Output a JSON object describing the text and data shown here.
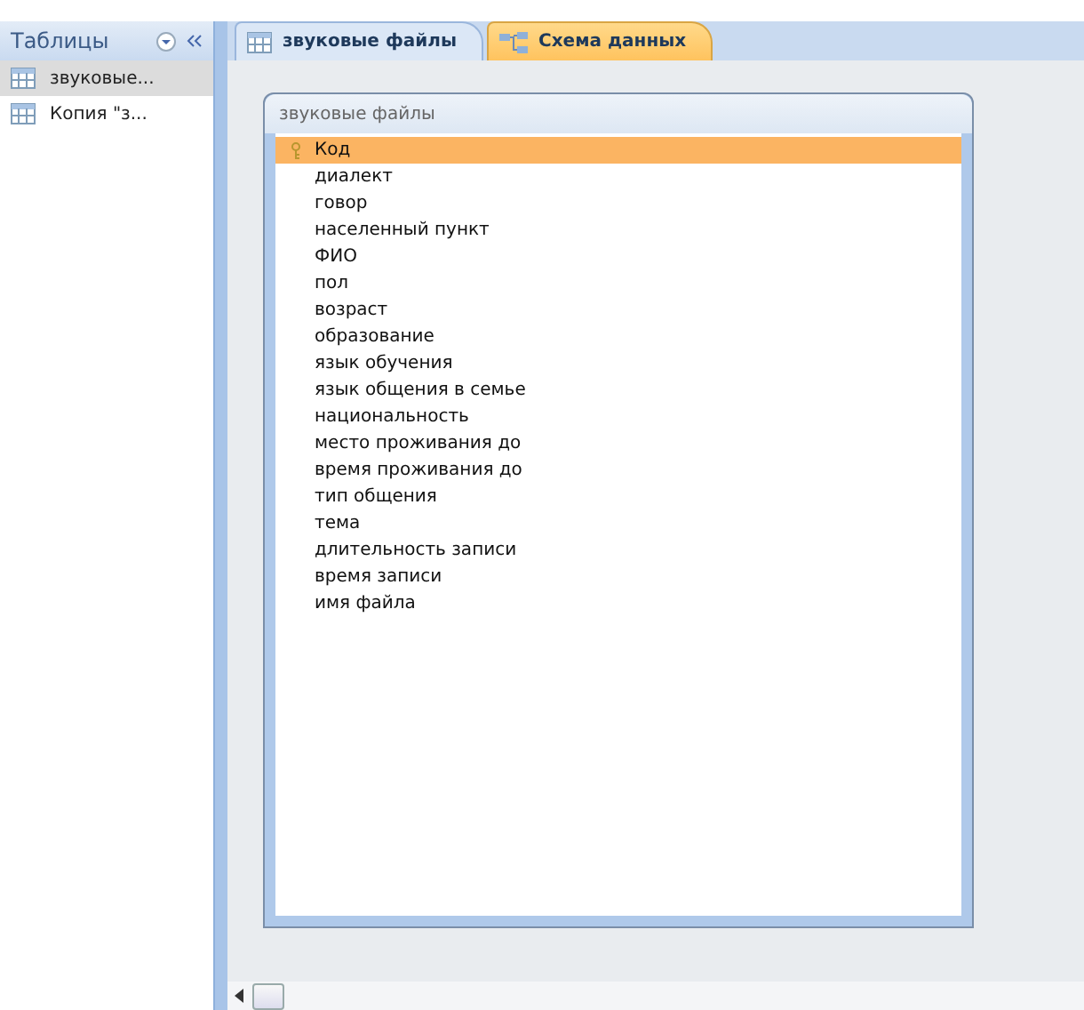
{
  "nav_pane": {
    "title": "Таблицы",
    "items": [
      {
        "label": "звуковые...",
        "selected": true
      },
      {
        "label": "Копия \"з...",
        "selected": false
      }
    ]
  },
  "tabs": [
    {
      "label": "звуковые файлы",
      "kind": "table",
      "selected": false
    },
    {
      "label": "Схема данных",
      "kind": "schema",
      "selected": true
    }
  ],
  "table_box": {
    "title": "звуковые файлы",
    "fields": [
      {
        "name": "Код",
        "primary_key": true,
        "selected": true
      },
      {
        "name": "диалект",
        "primary_key": false,
        "selected": false
      },
      {
        "name": "говор",
        "primary_key": false,
        "selected": false
      },
      {
        "name": "населенный пункт",
        "primary_key": false,
        "selected": false
      },
      {
        "name": "ФИО",
        "primary_key": false,
        "selected": false
      },
      {
        "name": "пол",
        "primary_key": false,
        "selected": false
      },
      {
        "name": "возраст",
        "primary_key": false,
        "selected": false
      },
      {
        "name": "образование",
        "primary_key": false,
        "selected": false
      },
      {
        "name": "язык обучения",
        "primary_key": false,
        "selected": false
      },
      {
        "name": "язык общения в семье",
        "primary_key": false,
        "selected": false
      },
      {
        "name": "национальность",
        "primary_key": false,
        "selected": false
      },
      {
        "name": "место проживания до",
        "primary_key": false,
        "selected": false
      },
      {
        "name": "время проживания до",
        "primary_key": false,
        "selected": false
      },
      {
        "name": "тип общения",
        "primary_key": false,
        "selected": false
      },
      {
        "name": "тема",
        "primary_key": false,
        "selected": false
      },
      {
        "name": "длительность записи",
        "primary_key": false,
        "selected": false
      },
      {
        "name": "время записи",
        "primary_key": false,
        "selected": false
      },
      {
        "name": "имя файла",
        "primary_key": false,
        "selected": false
      }
    ]
  }
}
